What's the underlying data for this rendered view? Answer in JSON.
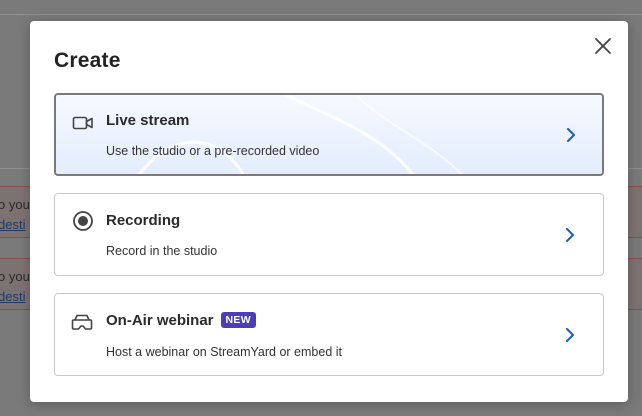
{
  "background": {
    "rows": [
      {
        "text": "o you",
        "link": "desti"
      },
      {
        "text": "o you",
        "link": "desti"
      }
    ]
  },
  "modal": {
    "title": "Create",
    "close_icon": "close-icon",
    "options": [
      {
        "title": "Live stream",
        "description": "Use the studio or a pre-recorded video",
        "icon": "video-camera-icon",
        "selected": true
      },
      {
        "title": "Recording",
        "description": "Record in the studio",
        "icon": "record-icon",
        "selected": false
      },
      {
        "title": "On-Air webinar",
        "badge": "NEW",
        "description": "Host a webinar on StreamYard or embed it",
        "icon": "vr-headset-icon",
        "selected": false
      }
    ]
  },
  "colors": {
    "accent": "#1a5fb4",
    "badge": "#4b3fb5",
    "selected_bg": "#e3edfd"
  }
}
